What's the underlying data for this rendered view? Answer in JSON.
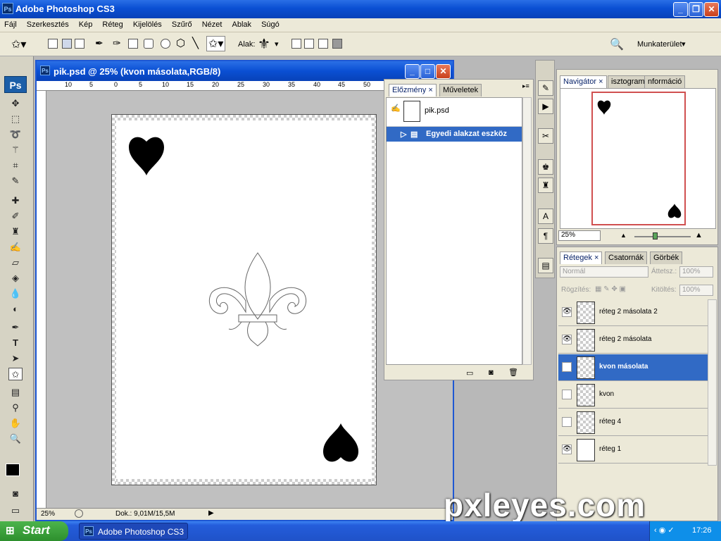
{
  "app": {
    "title": "Adobe Photoshop CS3",
    "logo": "Ps"
  },
  "menu": [
    "Fájl",
    "Szerkesztés",
    "Kép",
    "Réteg",
    "Kijelölés",
    "Szűrő",
    "Nézet",
    "Ablak",
    "Súgó"
  ],
  "options": {
    "shape_label": "Alak:",
    "workspace_label": "Munkaterület"
  },
  "document": {
    "title": "pik.psd @ 25% (kvon másolata,RGB/8)",
    "zoom": "25%",
    "doc_info": "Dok.: 9,01M/15,5M",
    "ruler_ticks": [
      "10",
      "5",
      "0",
      "5",
      "10",
      "15",
      "20",
      "25",
      "30",
      "35",
      "40",
      "45",
      "50"
    ]
  },
  "history_panel": {
    "tabs": [
      "Előzmény",
      "Műveletek"
    ],
    "snapshot": "pik.psd",
    "items": [
      "Egyedi alakzat eszköz"
    ]
  },
  "navigator_panel": {
    "tabs": [
      "Navigátor",
      "isztogram",
      "nformáció"
    ],
    "zoom": "25%"
  },
  "layers_panel": {
    "tabs": [
      "Rétegek",
      "Csatornák",
      "Görbék"
    ],
    "blend_mode": "Normál",
    "opacity_label": "Áttetsz.:",
    "opacity": "100%",
    "lock_label": "Rögzítés:",
    "fill_label": "Kitöltés:",
    "fill": "100%",
    "layers": [
      {
        "name": "réteg 2 másolata 2",
        "visible": true,
        "selected": false
      },
      {
        "name": "réteg 2 másolata",
        "visible": true,
        "selected": false
      },
      {
        "name": "kvon másolata",
        "visible": false,
        "selected": true
      },
      {
        "name": "kvon",
        "visible": false,
        "selected": false
      },
      {
        "name": "réteg 4",
        "visible": false,
        "selected": false
      },
      {
        "name": "réteg 1",
        "visible": true,
        "selected": false
      }
    ]
  },
  "taskbar": {
    "start": "Start",
    "item": "Adobe Photoshop CS3",
    "time": "17:26"
  },
  "watermark": "pxleyes.com"
}
